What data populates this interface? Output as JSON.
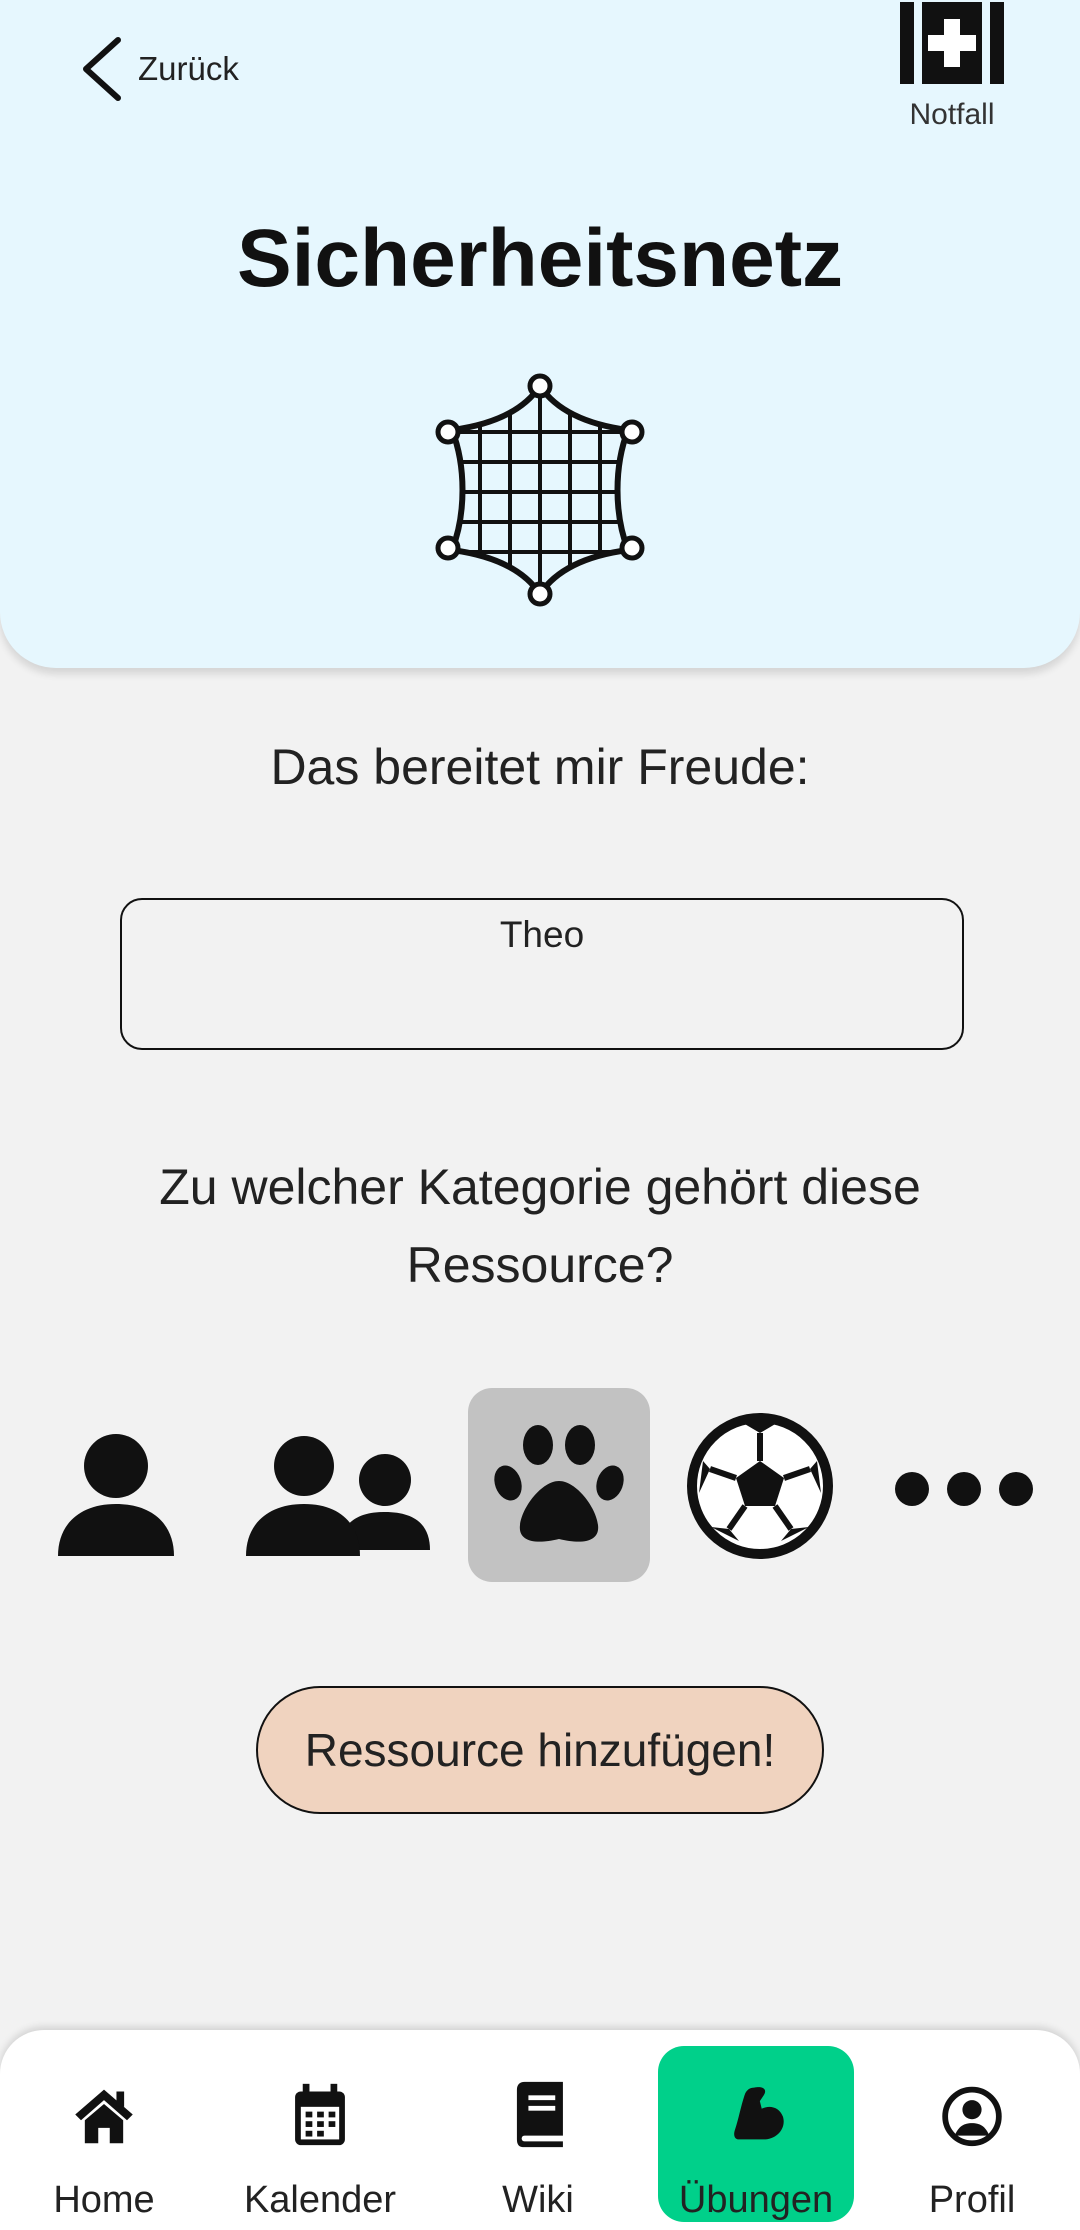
{
  "header": {
    "back_label": "Zurück",
    "emergency_label": "Notfall",
    "title": "Sicherheitsnetz"
  },
  "main": {
    "prompt": "Das bereitet mir Freude:",
    "input_value": "Theo",
    "question": "Zu welcher Kategorie gehört diese Ressource?",
    "categories": [
      {
        "icon": "person-icon",
        "selected": false
      },
      {
        "icon": "people-icon",
        "selected": false
      },
      {
        "icon": "paw-icon",
        "selected": true
      },
      {
        "icon": "soccer-ball-icon",
        "selected": false
      },
      {
        "icon": "more-icon",
        "selected": false
      }
    ],
    "add_button_label": "Ressource hinzufügen!"
  },
  "bottom_nav": {
    "items": [
      {
        "label": "Home",
        "icon": "home-icon"
      },
      {
        "label": "Kalender",
        "icon": "calendar-icon"
      },
      {
        "label": "Wiki",
        "icon": "book-icon"
      },
      {
        "label": "Übungen",
        "icon": "muscle-icon",
        "active": true
      },
      {
        "label": "Profil",
        "icon": "profile-icon"
      }
    ]
  },
  "colors": {
    "header_bg": "#e6f7fe",
    "page_bg": "#f2f2f2",
    "button_bg": "#f0d3bf",
    "active_nav": "#00d08a",
    "selected_category": "#c2c2c2"
  }
}
